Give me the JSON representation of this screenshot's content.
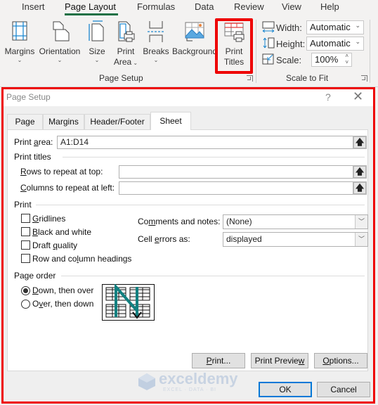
{
  "ribbon": {
    "tabs": [
      {
        "label": "Insert"
      },
      {
        "label": "Page Layout",
        "active": true
      },
      {
        "label": "Formulas"
      },
      {
        "label": "Data"
      },
      {
        "label": "Review"
      },
      {
        "label": "View"
      },
      {
        "label": "Help"
      }
    ],
    "page_setup_group": {
      "label": "Page Setup",
      "buttons": [
        {
          "label": "Margins",
          "icon": "margins-icon"
        },
        {
          "label": "Orientation",
          "icon": "orientation-icon"
        },
        {
          "label": "Size",
          "icon": "size-icon"
        },
        {
          "label": "Print",
          "label2": "Area",
          "icon": "print-area-icon"
        },
        {
          "label": "Breaks",
          "icon": "breaks-icon"
        },
        {
          "label": "Background",
          "icon": "background-icon"
        },
        {
          "label": "Print",
          "label2": "Titles",
          "icon": "print-titles-icon"
        }
      ]
    },
    "scale_to_fit_group": {
      "label": "Scale to Fit",
      "width_label": "Width:",
      "width_value": "Automatic",
      "height_label": "Height:",
      "height_value": "Automatic",
      "scale_label": "Scale:",
      "scale_value": "100%"
    },
    "highlight_color": "#ee0000",
    "active_tab_color": "#1e7145"
  },
  "dialog": {
    "title": "Page Setup",
    "help": "?",
    "close": "✕",
    "tabs": [
      {
        "label": "Page"
      },
      {
        "label": "Margins"
      },
      {
        "label": "Header/Footer"
      },
      {
        "label": "Sheet",
        "active": true
      }
    ],
    "print_area": {
      "label_pre": "Print ",
      "label_u": "a",
      "label_post": "rea:",
      "value": "A1:D14"
    },
    "print_titles": {
      "heading": "Print titles",
      "rows_label_u": "R",
      "rows_label_rest": "ows to repeat at top:",
      "rows_value": "",
      "cols_label_u": "C",
      "cols_label_rest": "olumns to repeat at left:",
      "cols_value": ""
    },
    "print": {
      "heading": "Print",
      "checkboxes": [
        {
          "pre": "",
          "u": "G",
          "post": "ridlines",
          "checked": false
        },
        {
          "pre": "",
          "u": "B",
          "post": "lack and white",
          "checked": false
        },
        {
          "pre": "Draft ",
          "u": "q",
          "post": "uality",
          "checked": false
        },
        {
          "pre": "Row and co",
          "u": "l",
          "post": "umn headings",
          "checked": false
        }
      ],
      "comments_label_pre": "Co",
      "comments_label_u": "m",
      "comments_label_post": "ments and notes:",
      "comments_value": "(None)",
      "errors_label_pre": "Cell ",
      "errors_label_u": "e",
      "errors_label_post": "rrors as:",
      "errors_value": "displayed"
    },
    "page_order": {
      "heading": "Page order",
      "options": [
        {
          "pre": "",
          "u": "D",
          "post": "own, then over",
          "selected": true
        },
        {
          "pre": "O",
          "u": "v",
          "post": "er, then down",
          "selected": false
        }
      ]
    },
    "buttons": {
      "print_u": "P",
      "print_rest": "rint...",
      "preview_pre": "Print Previe",
      "preview_u": "w",
      "options_u": "O",
      "options_rest": "ptions...",
      "ok": "OK",
      "cancel": "Cancel"
    }
  },
  "watermark": {
    "brand": "exceldemy",
    "tagline": "EXCEL · DATA · BI"
  }
}
